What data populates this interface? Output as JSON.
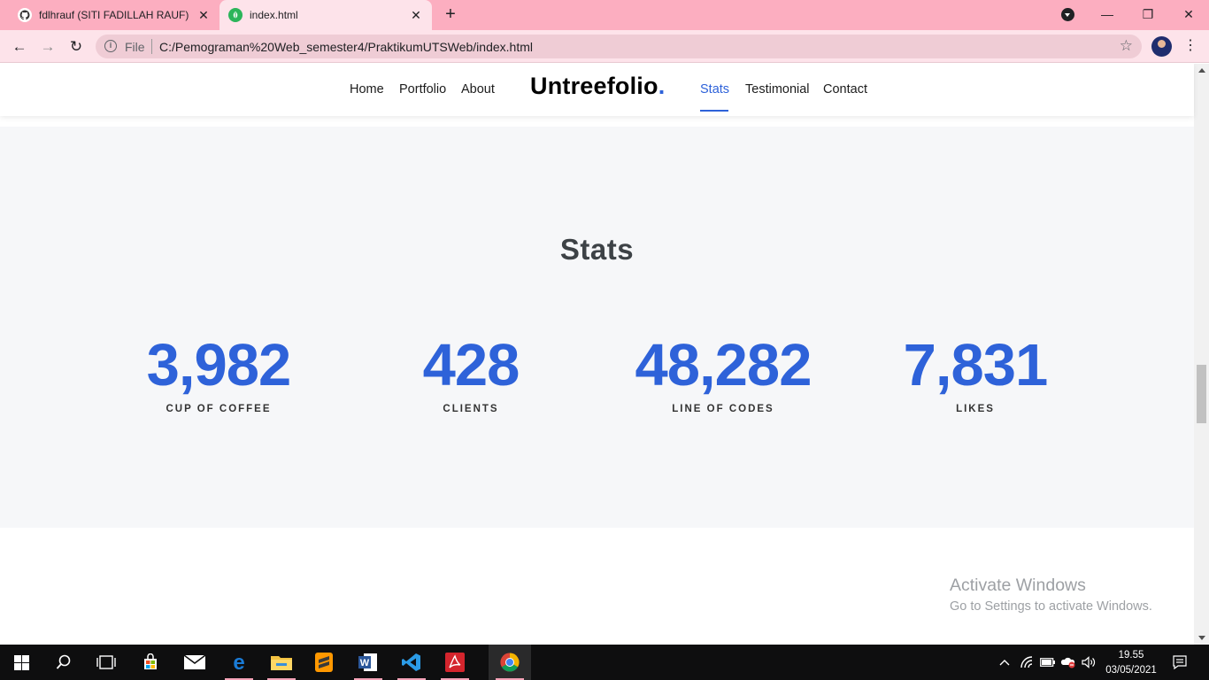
{
  "browser": {
    "tabs": [
      {
        "title": "fdlhrauf (SITI FADILLAH RAUF)",
        "icon": "github-icon",
        "active": false
      },
      {
        "title": "index.html",
        "icon": "leaf-icon",
        "active": true
      }
    ],
    "new_tab_symbol": "+",
    "window_controls": {
      "minimize": "—",
      "restore": "❐",
      "close": "✕"
    },
    "address": {
      "scheme_label": "File",
      "url": "C:/Pemograman%20Web_semester4/PraktikumUTSWeb/index.html"
    },
    "nav_icons": {
      "back": "←",
      "forward": "→",
      "reload": "↻",
      "star": "☆",
      "menu": "⋮"
    }
  },
  "site": {
    "nav_left": [
      "Home",
      "Portfolio",
      "About"
    ],
    "brand": {
      "text": "Untreefolio",
      "dot": "."
    },
    "nav_right": [
      "Stats",
      "Testimonial",
      "Contact"
    ],
    "active_nav": "Stats",
    "accent_color": "#2e62d9"
  },
  "stats": {
    "title": "Stats",
    "items": [
      {
        "value": "3,982",
        "label": "CUP OF COFFEE"
      },
      {
        "value": "428",
        "label": "CLIENTS"
      },
      {
        "value": "48,282",
        "label": "LINE OF CODES"
      },
      {
        "value": "7,831",
        "label": "LIKES"
      }
    ]
  },
  "watermark": {
    "title": "Activate Windows",
    "subtitle": "Go to Settings to activate Windows."
  },
  "taskbar": {
    "apps": [
      "windows-start-icon",
      "search-icon",
      "task-view-icon",
      "store-icon",
      "mail-icon",
      "edge-icon",
      "file-explorer-icon",
      "sublime-text-icon",
      "word-icon",
      "vscode-icon",
      "acrobat-icon",
      "chrome-icon"
    ],
    "clock": {
      "time": "19.55",
      "date": "03/05/2021"
    }
  }
}
